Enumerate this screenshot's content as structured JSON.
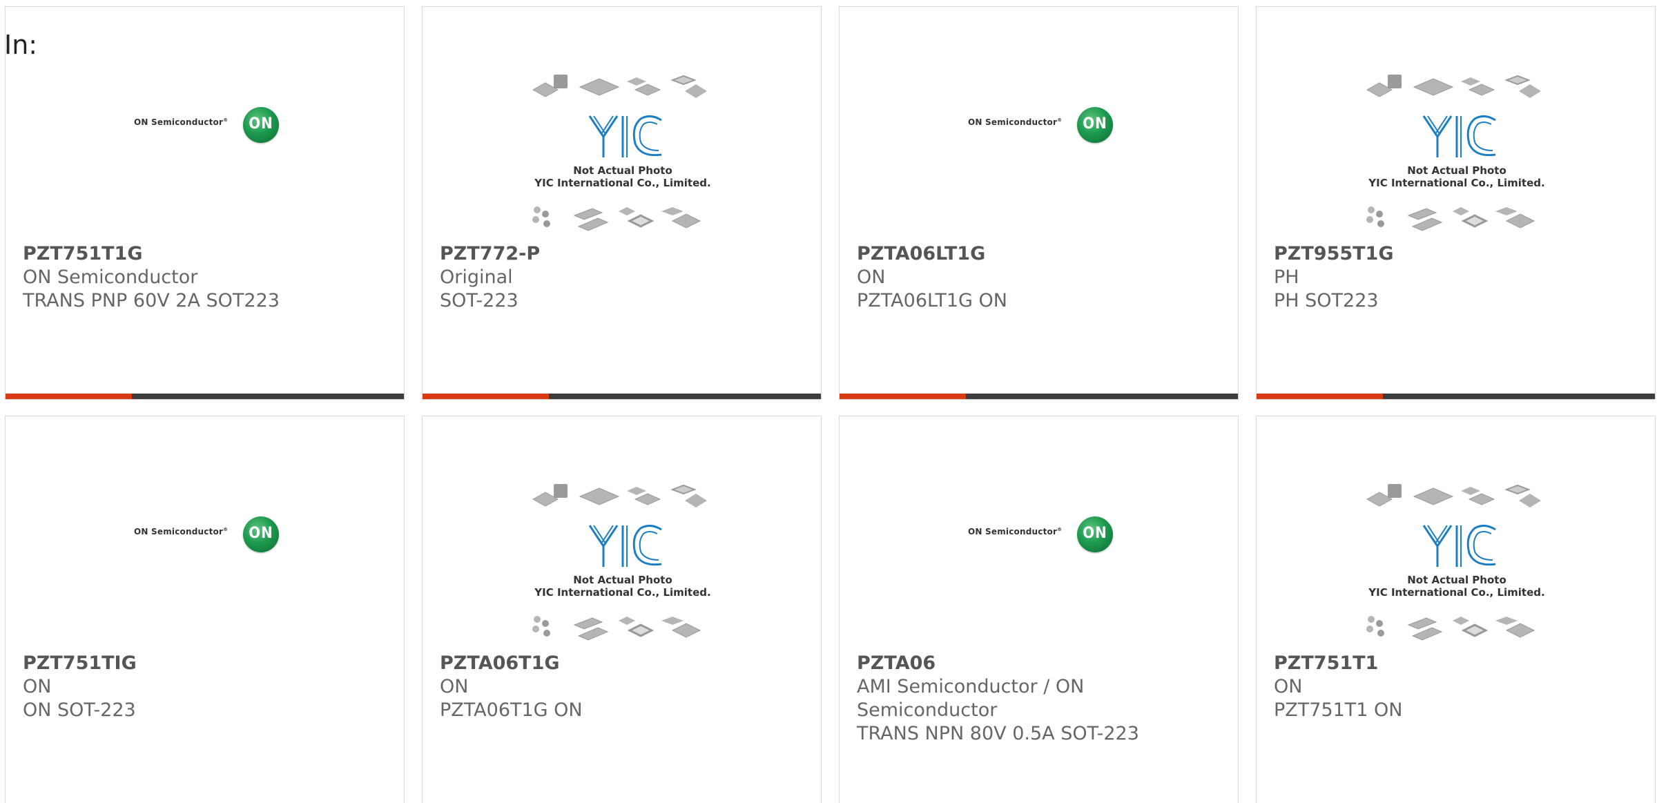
{
  "header": {
    "in_label": "In:"
  },
  "logo_text": {
    "on_semi": "ON Semiconductor",
    "on_badge": "ON",
    "yic_line1": "Not Actual Photo",
    "yic_line2": "YIC International Co., Limited."
  },
  "colors": {
    "accent": "#d93a16",
    "bar": "#3c3c3c",
    "on_green": "#1d9a4f",
    "yic_blue": "#1b7fc4"
  },
  "products": [
    {
      "part": "PZT751T1G",
      "brand": "ON Semiconductor",
      "desc": "TRANS PNP 60V 2A SOT223",
      "image": "on-semiconductor-logo"
    },
    {
      "part": "PZT772-P",
      "brand": "Original",
      "desc": "SOT-223",
      "image": "yic-placeholder"
    },
    {
      "part": "PZTA06LT1G",
      "brand": "ON",
      "desc": "PZTA06LT1G ON",
      "image": "on-semiconductor-logo"
    },
    {
      "part": "PZT955T1G",
      "brand": "PH",
      "desc": "PH SOT223",
      "image": "yic-placeholder"
    },
    {
      "part": "PZT751TIG",
      "brand": "ON",
      "desc": "ON SOT-223",
      "image": "on-semiconductor-logo"
    },
    {
      "part": "PZTA06T1G",
      "brand": "ON",
      "desc": "PZTA06T1G ON",
      "image": "yic-placeholder"
    },
    {
      "part": "PZTA06",
      "brand": "AMI Semiconductor / ON Semiconductor",
      "desc": "TRANS NPN 80V 0.5A SOT-223",
      "image": "on-semiconductor-logo"
    },
    {
      "part": "PZT751T1",
      "brand": "ON",
      "desc": "PZT751T1 ON",
      "image": "yic-placeholder"
    }
  ]
}
